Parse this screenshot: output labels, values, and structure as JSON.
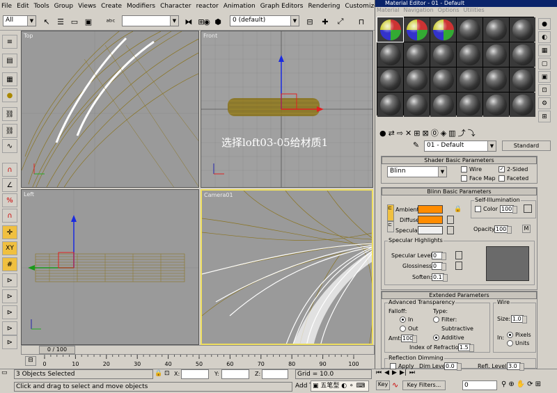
{
  "menu": [
    "File",
    "Edit",
    "Tools",
    "Group",
    "Views",
    "Create",
    "Modifiers",
    "Character",
    "reactor",
    "Animation",
    "Graph Editors",
    "Rendering",
    "Customize",
    "CAT",
    "MA"
  ],
  "toolbar": {
    "selection_filter": "All",
    "named_selection": "",
    "layer": "0 (default)"
  },
  "viewports": [
    {
      "label": "Top"
    },
    {
      "label": "Front"
    },
    {
      "label": "Left"
    },
    {
      "label": "Camera01"
    }
  ],
  "annotation": "选择loft03-05给材质1",
  "timeline": {
    "frame": "0 / 100",
    "ticks": [
      "0",
      "10",
      "20",
      "30",
      "40",
      "50",
      "60",
      "70",
      "80",
      "90",
      "100"
    ]
  },
  "status": {
    "selected": "3 Objects Selected",
    "prompt": "Click and drag to select and move objects",
    "x": "",
    "y": "",
    "z": "",
    "grid": "Grid = 10.0",
    "add_time_tag": "Add T",
    "ime_label": "五笔型",
    "key_label": "Key",
    "key_filters": "Key Filters...",
    "frame_value": "0",
    "x_label": "X:",
    "y_label": "Y:",
    "z_label": "Z:"
  },
  "material_editor": {
    "title": "Material Editor - 01 - Default",
    "tabs": [
      "Material",
      "Navigation",
      "Options",
      "Utilities"
    ],
    "material_name": "01 - Default",
    "material_type": "Standard",
    "shader_basic": {
      "title": "Shader Basic Parameters",
      "shader": "Blinn",
      "wire": "Wire",
      "two_sided": "2-Sided",
      "face_map": "Face Map",
      "faceted": "Faceted"
    },
    "blinn_basic": {
      "title": "Blinn Basic Parameters",
      "self_illum": "Self-Illumination",
      "color_label": "Color",
      "color_value": "100",
      "ambient": "Ambient:",
      "diffuse": "Diffuse:",
      "specular": "Specular:",
      "opacity_label": "Opacity:",
      "opacity_value": "100",
      "ambient_color": "#ff8c00",
      "diffuse_color": "#ff8c00",
      "specular_color": "#f0f0f0"
    },
    "specular_highlights": {
      "title": "Specular Highlights",
      "level_label": "Specular Level:",
      "level": "0",
      "gloss_label": "Glossiness:",
      "gloss": "0",
      "soften_label": "Soften:",
      "soften": "0.1"
    },
    "extended": {
      "title": "Extended Parameters",
      "adv_trans": "Advanced Transparency",
      "falloff": "Falloff:",
      "type": "Type:",
      "in": "In",
      "out": "Out",
      "filter": "Filter:",
      "subtractive": "Subtractive",
      "additive": "Additive",
      "amt_label": "Amt:",
      "amt": "100",
      "ior_label": "Index of Refraction:",
      "ior": "1.5",
      "wire": "Wire",
      "size_label": "Size:",
      "size": "1.0",
      "in_label": "In:",
      "pixels": "Pixels",
      "units": "Units",
      "refl_dim": "Reflection Dimming",
      "apply": "Apply",
      "dim_label": "Dim Level:",
      "dim": "0.0",
      "refl_label": "Refl. Level:",
      "refl": "3.0"
    }
  }
}
